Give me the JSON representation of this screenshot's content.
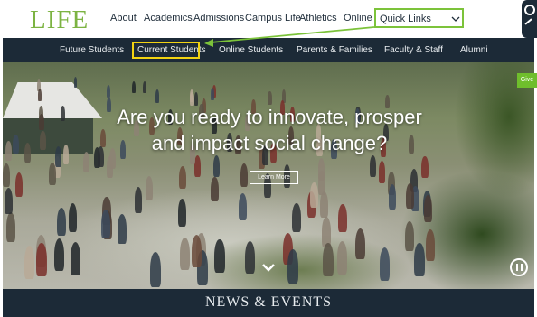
{
  "brand": {
    "logo_text": "LIFE",
    "accent_color": "#7cb342",
    "navy_color": "#1c2a37"
  },
  "main_nav": [
    "About",
    "Academics",
    "Admissions",
    "Campus Life",
    "Athletics",
    "Online"
  ],
  "quick_links": {
    "label": "Quick Links",
    "icon": "chevron-down-icon"
  },
  "sub_nav": [
    "Future Students",
    "Current Students",
    "Online Students",
    "Parents & Families",
    "Faculty & Staff",
    "Alumni"
  ],
  "highlighted_item": "Current Students",
  "hero": {
    "headline_line1": "Are you ready to innovate, prosper",
    "headline_line2": "and impact social change?",
    "button_label": "Learn More",
    "give_label": "Give"
  },
  "section_title": "NEWS & EVENTS"
}
